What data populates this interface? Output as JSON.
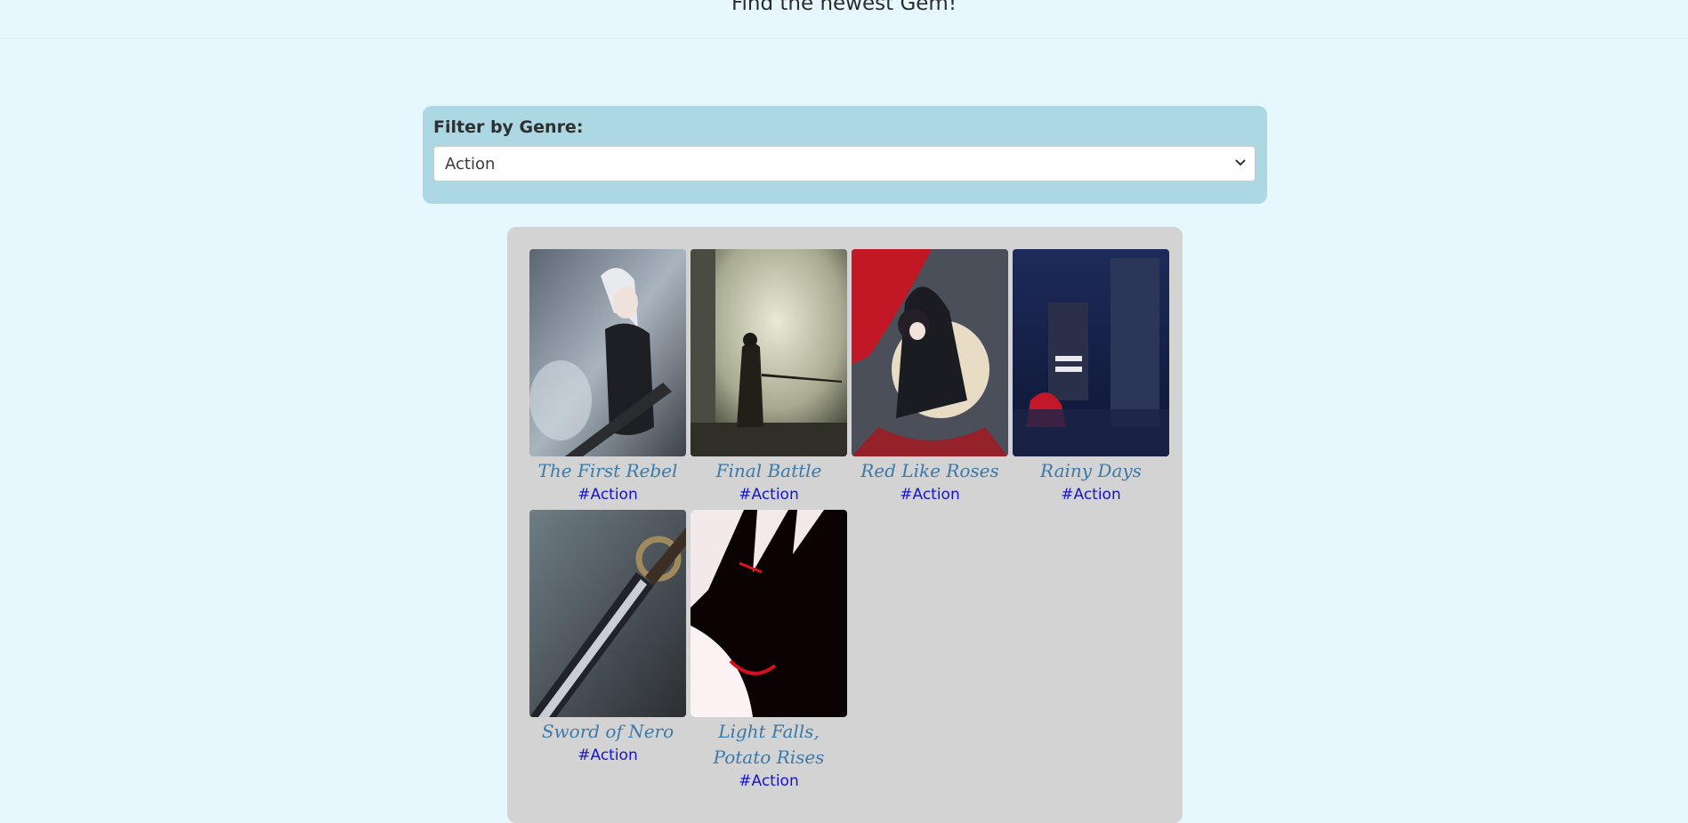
{
  "header": {
    "tagline": "Find the newest Gem!"
  },
  "filter": {
    "label": "Filter by Genre:",
    "selected": "Action"
  },
  "colors": {
    "page_bg": "#e6f8fd",
    "filter_bg": "#acd8e4",
    "gallery_bg": "#d3d3d3",
    "title": "#3c79a8",
    "tag": "#1616c8"
  },
  "books": [
    {
      "title": "The First Rebel",
      "tag": "#Action"
    },
    {
      "title": "Final Battle",
      "tag": "#Action"
    },
    {
      "title": "Red Like Roses",
      "tag": "#Action"
    },
    {
      "title": "Rainy Days",
      "tag": "#Action"
    },
    {
      "title": "Sword of Nero",
      "tag": "#Action"
    },
    {
      "title": "Light Falls, Potato Rises",
      "tag": "#Action"
    }
  ]
}
